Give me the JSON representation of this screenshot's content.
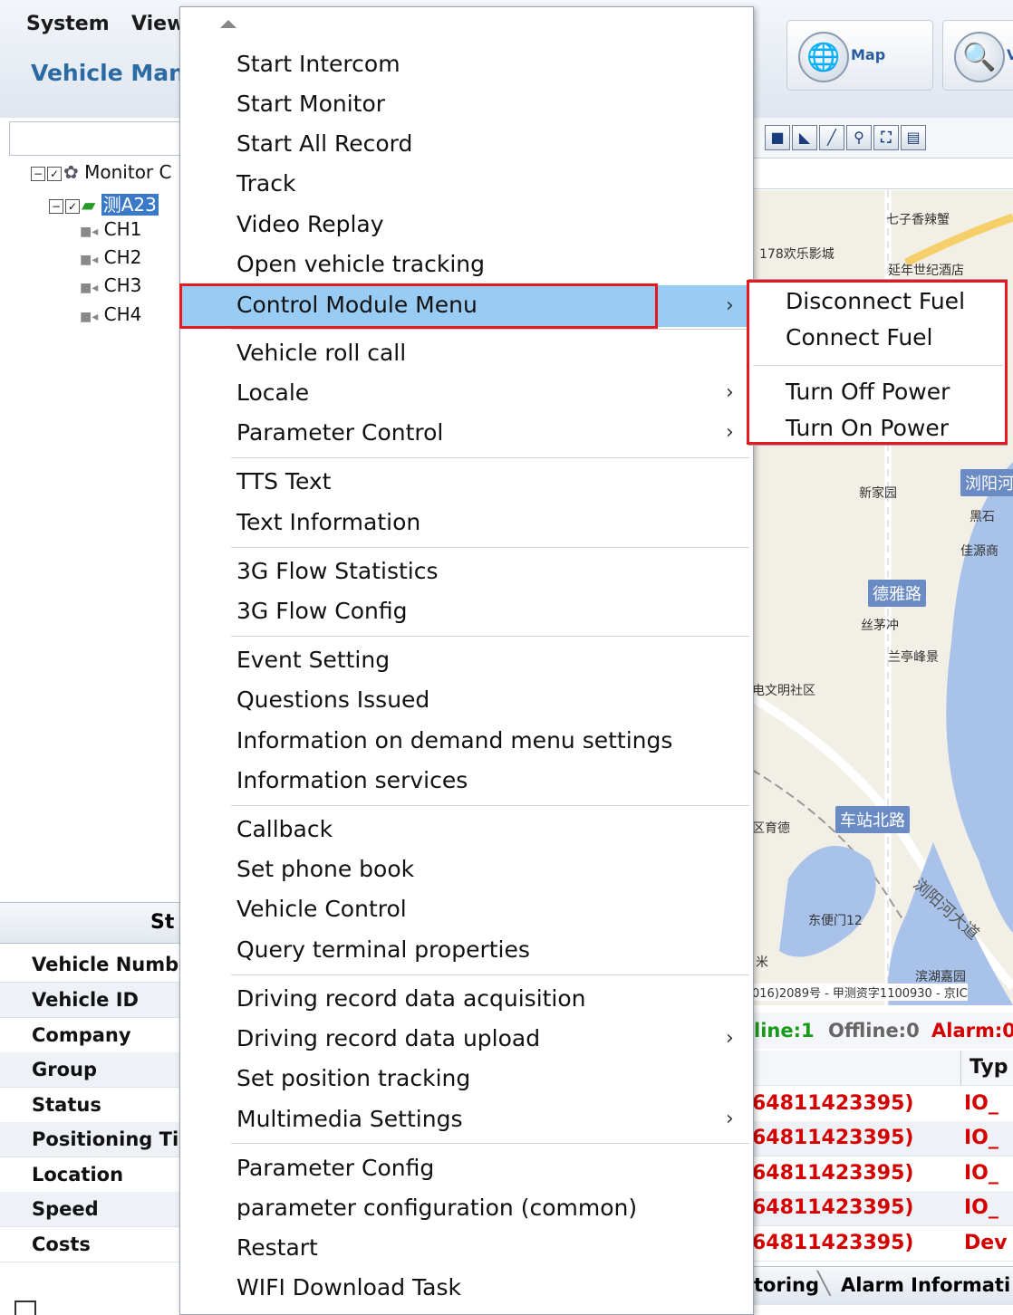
{
  "menubar": {
    "items": [
      "System",
      "View"
    ]
  },
  "app_title": "Vehicle Mana",
  "toolbar": {
    "map_label": "Map",
    "v_label": "V"
  },
  "tree": {
    "root": "Monitor C",
    "vehicle": "测A23",
    "channels": [
      "CH1",
      "CH2",
      "CH3",
      "CH4"
    ]
  },
  "left_tab": "St",
  "properties": [
    "Vehicle Numbe",
    "Vehicle ID",
    "Company",
    "Group",
    "Status",
    "Positioning Ti",
    "Location",
    "Speed",
    "Costs"
  ],
  "context_menu": {
    "items": [
      {
        "label": "Start Intercom"
      },
      {
        "label": "Start Monitor"
      },
      {
        "label": "Start All Record"
      },
      {
        "label": "Track"
      },
      {
        "label": "Video Replay"
      },
      {
        "label": "Open vehicle tracking"
      },
      {
        "label": "Control Module Menu",
        "submenu": true,
        "highlighted": true
      },
      {
        "label": "Vehicle roll call"
      },
      {
        "label": "Locale",
        "submenu": true
      },
      {
        "label": "Parameter Control",
        "submenu": true
      },
      {
        "label": "TTS Text"
      },
      {
        "label": "Text Information"
      },
      {
        "label": "3G Flow Statistics"
      },
      {
        "label": "3G Flow Config"
      },
      {
        "label": "Event Setting"
      },
      {
        "label": "Questions Issued"
      },
      {
        "label": "Information on demand menu settings"
      },
      {
        "label": "Information services"
      },
      {
        "label": "Callback"
      },
      {
        "label": "Set phone book"
      },
      {
        "label": "Vehicle Control"
      },
      {
        "label": "Query terminal properties"
      },
      {
        "label": "Driving record data acquisition"
      },
      {
        "label": "Driving record data upload",
        "submenu": true
      },
      {
        "label": "Set position tracking"
      },
      {
        "label": "Multimedia Settings",
        "submenu": true
      },
      {
        "label": "Parameter Config"
      },
      {
        "label": "parameter configuration (common)"
      },
      {
        "label": "Restart"
      },
      {
        "label": "WIFI Download Task"
      }
    ]
  },
  "submenu": {
    "items": [
      "Disconnect Fuel",
      "Connect Fuel",
      "Turn Off Power",
      "Turn On Power"
    ]
  },
  "map": {
    "labels": [
      "七子香辣蟹",
      "178欢乐影城",
      "延年世纪酒店",
      "新家园",
      "浏阳河",
      "黑石",
      "佳源商",
      "丝茅冲",
      "兰亭峰景",
      "电文明社区",
      "区育德",
      "东便门12",
      "滨湖嘉园",
      "米"
    ],
    "roads": [
      "德雅路",
      "车站北路",
      "浏阳河大道"
    ],
    "copyright": "016)2089号 - 甲测资字1100930 - 京IC"
  },
  "status_line": {
    "online": "line:1",
    "offline": "Offline:0",
    "alarm": "Alarm:0"
  },
  "grid": {
    "header": "Typ",
    "rows": [
      {
        "id": "64811423395)",
        "type": "IO_"
      },
      {
        "id": "64811423395)",
        "type": "IO_"
      },
      {
        "id": "64811423395)",
        "type": "IO_"
      },
      {
        "id": "64811423395)",
        "type": "IO_"
      },
      {
        "id": "64811423395)",
        "type": "Dev"
      }
    ]
  },
  "bottom_tabs": [
    "toring",
    "Alarm Informati"
  ]
}
